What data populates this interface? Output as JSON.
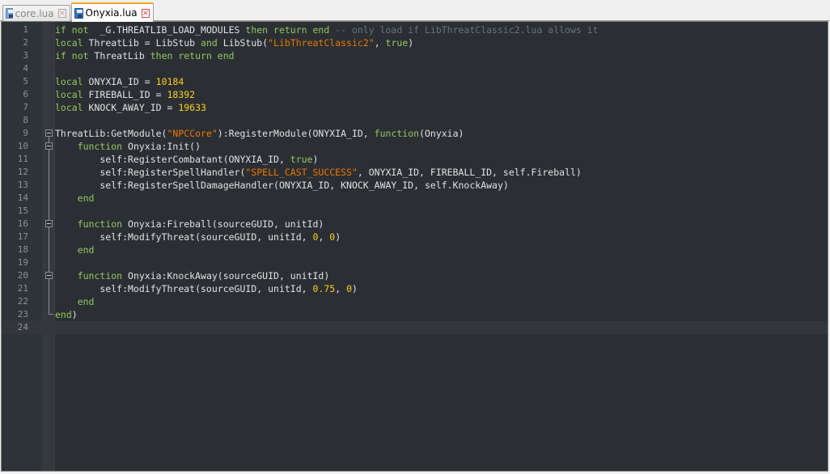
{
  "tabs": [
    {
      "label": "core.lua",
      "active": false
    },
    {
      "label": "Onyxia.lua",
      "active": true
    }
  ],
  "editor": {
    "current_line": 24,
    "colors": {
      "background": "#2b2f33",
      "keyword": "#93c763",
      "number": "#ffcd22",
      "string": "#ec7600",
      "comment": "#66747b",
      "text": "#e0e2e4"
    },
    "lines": [
      [
        [
          "kw",
          "if not "
        ],
        [
          "t",
          " _G.THREATLIB_LOAD_MODULES "
        ],
        [
          "kw",
          "then return end"
        ],
        [
          "cmt",
          " -- only load if LibThreatClassic2.lua allows it"
        ]
      ],
      [
        [
          "kw",
          "local"
        ],
        [
          "t",
          " ThreatLib = LibStub "
        ],
        [
          "kw",
          "and"
        ],
        [
          "t",
          " LibStub("
        ],
        [
          "str",
          "\"LibThreatClassic2\""
        ],
        [
          "t",
          ", "
        ],
        [
          "kw",
          "true"
        ],
        [
          "t",
          ")"
        ]
      ],
      [
        [
          "kw",
          "if not"
        ],
        [
          "t",
          " ThreatLib "
        ],
        [
          "kw",
          "then return end"
        ]
      ],
      [],
      [
        [
          "kw",
          "local"
        ],
        [
          "t",
          " ONYXIA_ID = "
        ],
        [
          "num",
          "10184"
        ]
      ],
      [
        [
          "kw",
          "local"
        ],
        [
          "t",
          " FIREBALL_ID = "
        ],
        [
          "num",
          "18392"
        ]
      ],
      [
        [
          "kw",
          "local"
        ],
        [
          "t",
          " KNOCK_AWAY_ID = "
        ],
        [
          "num",
          "19633"
        ]
      ],
      [],
      [
        [
          "t",
          "ThreatLib:GetModule("
        ],
        [
          "str",
          "\"NPCCore\""
        ],
        [
          "t",
          "):RegisterModule(ONYXIA_ID, "
        ],
        [
          "kw",
          "function"
        ],
        [
          "t",
          "(Onyxia)"
        ]
      ],
      [
        [
          "t",
          "    "
        ],
        [
          "kw",
          "function"
        ],
        [
          "t",
          " Onyxia:Init()"
        ]
      ],
      [
        [
          "t",
          "        self:RegisterCombatant(ONYXIA_ID, "
        ],
        [
          "kw",
          "true"
        ],
        [
          "t",
          ")"
        ]
      ],
      [
        [
          "t",
          "        self:RegisterSpellHandler("
        ],
        [
          "str",
          "\"SPELL_CAST_SUCCESS\""
        ],
        [
          "t",
          ", ONYXIA_ID, FIREBALL_ID, self.Fireball)"
        ]
      ],
      [
        [
          "t",
          "        self:RegisterSpellDamageHandler(ONYXIA_ID, KNOCK_AWAY_ID, self.KnockAway)"
        ]
      ],
      [
        [
          "t",
          "    "
        ],
        [
          "kw",
          "end"
        ]
      ],
      [],
      [
        [
          "t",
          "    "
        ],
        [
          "kw",
          "function"
        ],
        [
          "t",
          " Onyxia:Fireball(sourceGUID, unitId)"
        ]
      ],
      [
        [
          "t",
          "        self:ModifyThreat(sourceGUID, unitId, "
        ],
        [
          "num",
          "0"
        ],
        [
          "t",
          ", "
        ],
        [
          "num",
          "0"
        ],
        [
          "t",
          ")"
        ]
      ],
      [
        [
          "t",
          "    "
        ],
        [
          "kw",
          "end"
        ]
      ],
      [],
      [
        [
          "t",
          "    "
        ],
        [
          "kw",
          "function"
        ],
        [
          "t",
          " Onyxia:KnockAway(sourceGUID, unitId)"
        ]
      ],
      [
        [
          "t",
          "        self:ModifyThreat(sourceGUID, unitId, "
        ],
        [
          "num",
          "0.75"
        ],
        [
          "t",
          ", "
        ],
        [
          "num",
          "0"
        ],
        [
          "t",
          ")"
        ]
      ],
      [
        [
          "t",
          "    "
        ],
        [
          "kw",
          "end"
        ]
      ],
      [
        [
          "kw",
          "end"
        ],
        [
          "t",
          ")"
        ]
      ],
      []
    ],
    "folds": {
      "open": [
        9,
        10,
        16,
        20
      ],
      "inside": [
        11,
        12,
        13,
        14,
        15,
        17,
        18,
        19,
        21,
        22
      ],
      "close": [
        23
      ]
    }
  }
}
